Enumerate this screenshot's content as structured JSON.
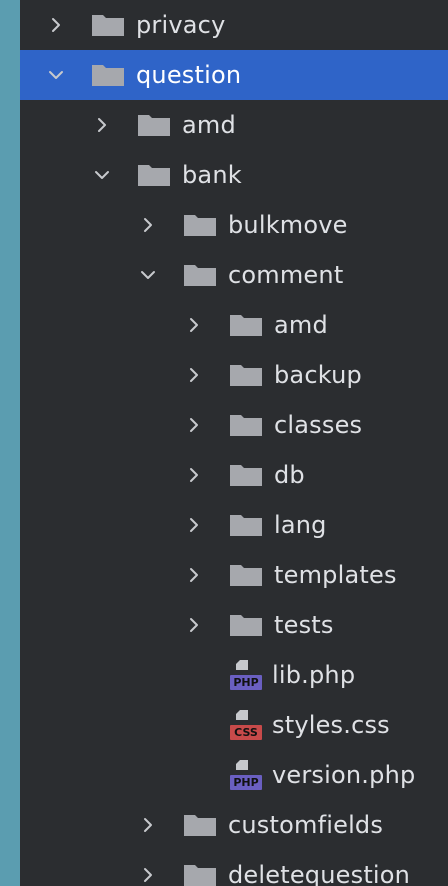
{
  "tree": {
    "items": [
      {
        "label": "privacy",
        "kind": "folder",
        "expanded": false,
        "depth": 0
      },
      {
        "label": "question",
        "kind": "folder",
        "expanded": true,
        "depth": 0,
        "selected": true
      },
      {
        "label": "amd",
        "kind": "folder",
        "expanded": false,
        "depth": 1
      },
      {
        "label": "bank",
        "kind": "folder",
        "expanded": true,
        "depth": 1
      },
      {
        "label": "bulkmove",
        "kind": "folder",
        "expanded": false,
        "depth": 2
      },
      {
        "label": "comment",
        "kind": "folder",
        "expanded": true,
        "depth": 2
      },
      {
        "label": "amd",
        "kind": "folder",
        "expanded": false,
        "depth": 3
      },
      {
        "label": "backup",
        "kind": "folder",
        "expanded": false,
        "depth": 3
      },
      {
        "label": "classes",
        "kind": "folder",
        "expanded": false,
        "depth": 3
      },
      {
        "label": "db",
        "kind": "folder",
        "expanded": false,
        "depth": 3
      },
      {
        "label": "lang",
        "kind": "folder",
        "expanded": false,
        "depth": 3
      },
      {
        "label": "templates",
        "kind": "folder",
        "expanded": false,
        "depth": 3
      },
      {
        "label": "tests",
        "kind": "folder",
        "expanded": false,
        "depth": 3
      },
      {
        "label": "lib.php",
        "kind": "php",
        "badge": "PHP",
        "depth": 3
      },
      {
        "label": "styles.css",
        "kind": "css",
        "badge": "CSS",
        "depth": 3
      },
      {
        "label": "version.php",
        "kind": "php",
        "badge": "PHP",
        "depth": 3
      },
      {
        "label": "customfields",
        "kind": "folder",
        "expanded": false,
        "depth": 2
      },
      {
        "label": "deletequestion",
        "kind": "folder",
        "expanded": false,
        "depth": 2
      }
    ]
  },
  "colors": {
    "panel_bg": "#2b2d30",
    "selection": "#2f64c8",
    "folder": "#a6a8ad",
    "php_badge": "#6a5fc1",
    "css_badge": "#c84a4a",
    "text": "#dfe1e5",
    "outer_bg": "#5b9db0"
  }
}
